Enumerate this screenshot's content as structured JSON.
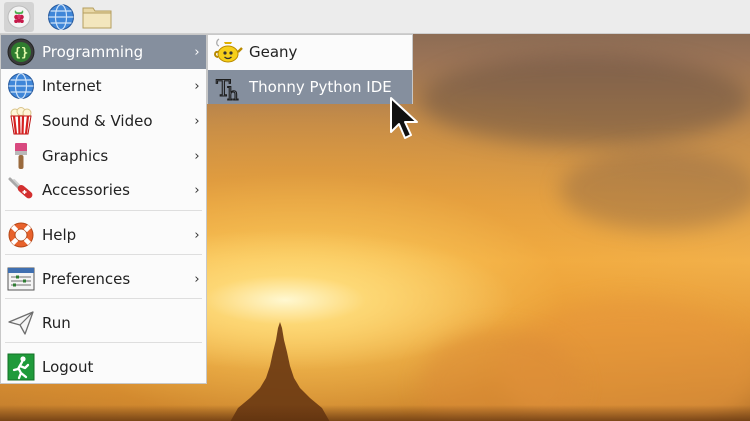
{
  "taskbar": {
    "menu_icon": "raspberry-pi-icon",
    "web_browser_icon": "globe-icon",
    "file_manager_icon": "folder-icon"
  },
  "main_menu": {
    "items": [
      {
        "label": "Programming",
        "icon": "programming-braces-icon",
        "has_submenu": true,
        "active": true
      },
      {
        "label": "Internet",
        "icon": "globe-icon",
        "has_submenu": true
      },
      {
        "label": "Sound & Video",
        "icon": "popcorn-icon",
        "has_submenu": true
      },
      {
        "label": "Graphics",
        "icon": "paintbrush-icon",
        "has_submenu": true
      },
      {
        "label": "Accessories",
        "icon": "swiss-knife-icon",
        "has_submenu": true
      },
      {
        "label": "Help",
        "icon": "lifebuoy-icon",
        "has_submenu": true
      },
      {
        "label": "Preferences",
        "icon": "settings-window-icon",
        "has_submenu": true
      },
      {
        "label": "Run",
        "icon": "paper-plane-icon",
        "has_submenu": false
      },
      {
        "label": "Logout",
        "icon": "exit-icon",
        "has_submenu": false
      }
    ],
    "submenu_arrow": "›"
  },
  "programming_submenu": {
    "items": [
      {
        "label": "Geany",
        "icon": "geany-teapot-icon"
      },
      {
        "label": "Thonny Python IDE",
        "icon": "thonny-icon",
        "highlighted": true
      }
    ]
  },
  "colors": {
    "menu_highlight": "#858f9e",
    "menu_background": "#fbfbfb",
    "taskbar_background": "#ececec"
  }
}
